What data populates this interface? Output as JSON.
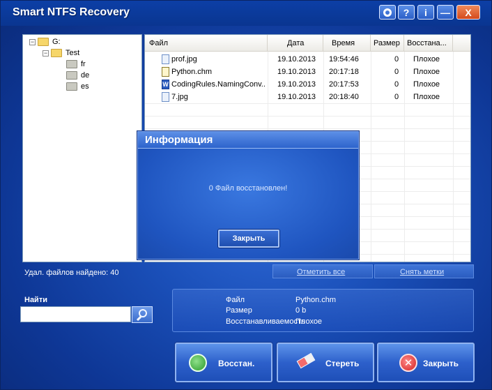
{
  "app": {
    "title": "Smart NTFS Recovery"
  },
  "titlebar": {
    "settings_icon": "gear-icon",
    "help_label": "?",
    "info_label": "i",
    "minimize_label": "—",
    "close_label": "X"
  },
  "tree": {
    "nodes": [
      {
        "label": "G:",
        "expander": "−"
      },
      {
        "label": "Test",
        "expander": "−"
      },
      {
        "label": "fr"
      },
      {
        "label": "de"
      },
      {
        "label": "es"
      }
    ]
  },
  "filelist": {
    "columns": [
      "Файл",
      "Дата",
      "Время",
      "Размер",
      "Восстана..."
    ],
    "rows": [
      {
        "name": "prof.jpg",
        "date": "19.10.2013",
        "time": "19:54:46",
        "size": "0",
        "status": "Плохое",
        "icon": "image-file-icon"
      },
      {
        "name": "Python.chm",
        "date": "19.10.2013",
        "time": "20:17:18",
        "size": "0",
        "status": "Плохое",
        "icon": "help-file-icon"
      },
      {
        "name": "CodingRules.NamingConv...",
        "date": "19.10.2013",
        "time": "20:17:53",
        "size": "0",
        "status": "Плохое",
        "icon": "word-file-icon"
      },
      {
        "name": "7.jpg",
        "date": "19.10.2013",
        "time": "20:18:40",
        "size": "0",
        "status": "Плохое",
        "icon": "image-file-icon"
      }
    ]
  },
  "status": {
    "found": "Удал. файлов найдено: 40"
  },
  "links": {
    "select_all": "Отметить все",
    "deselect": "Снять метки"
  },
  "search": {
    "label": "Найти",
    "value": ""
  },
  "details": {
    "file_label": "Файл",
    "file_value": "Python.chm",
    "size_label": "Размер",
    "size_value": "0 b",
    "recoverable_label": "Восстанавливаемость",
    "recoverable_value": "Плохое"
  },
  "actions": {
    "restore": "Восстан.",
    "erase": "Стереть",
    "close": "Закрыть"
  },
  "dialog": {
    "title": "Информация",
    "message": "0 Файл восстановлен!",
    "close_button": "Закрыть"
  },
  "word_icon_letter": "W"
}
